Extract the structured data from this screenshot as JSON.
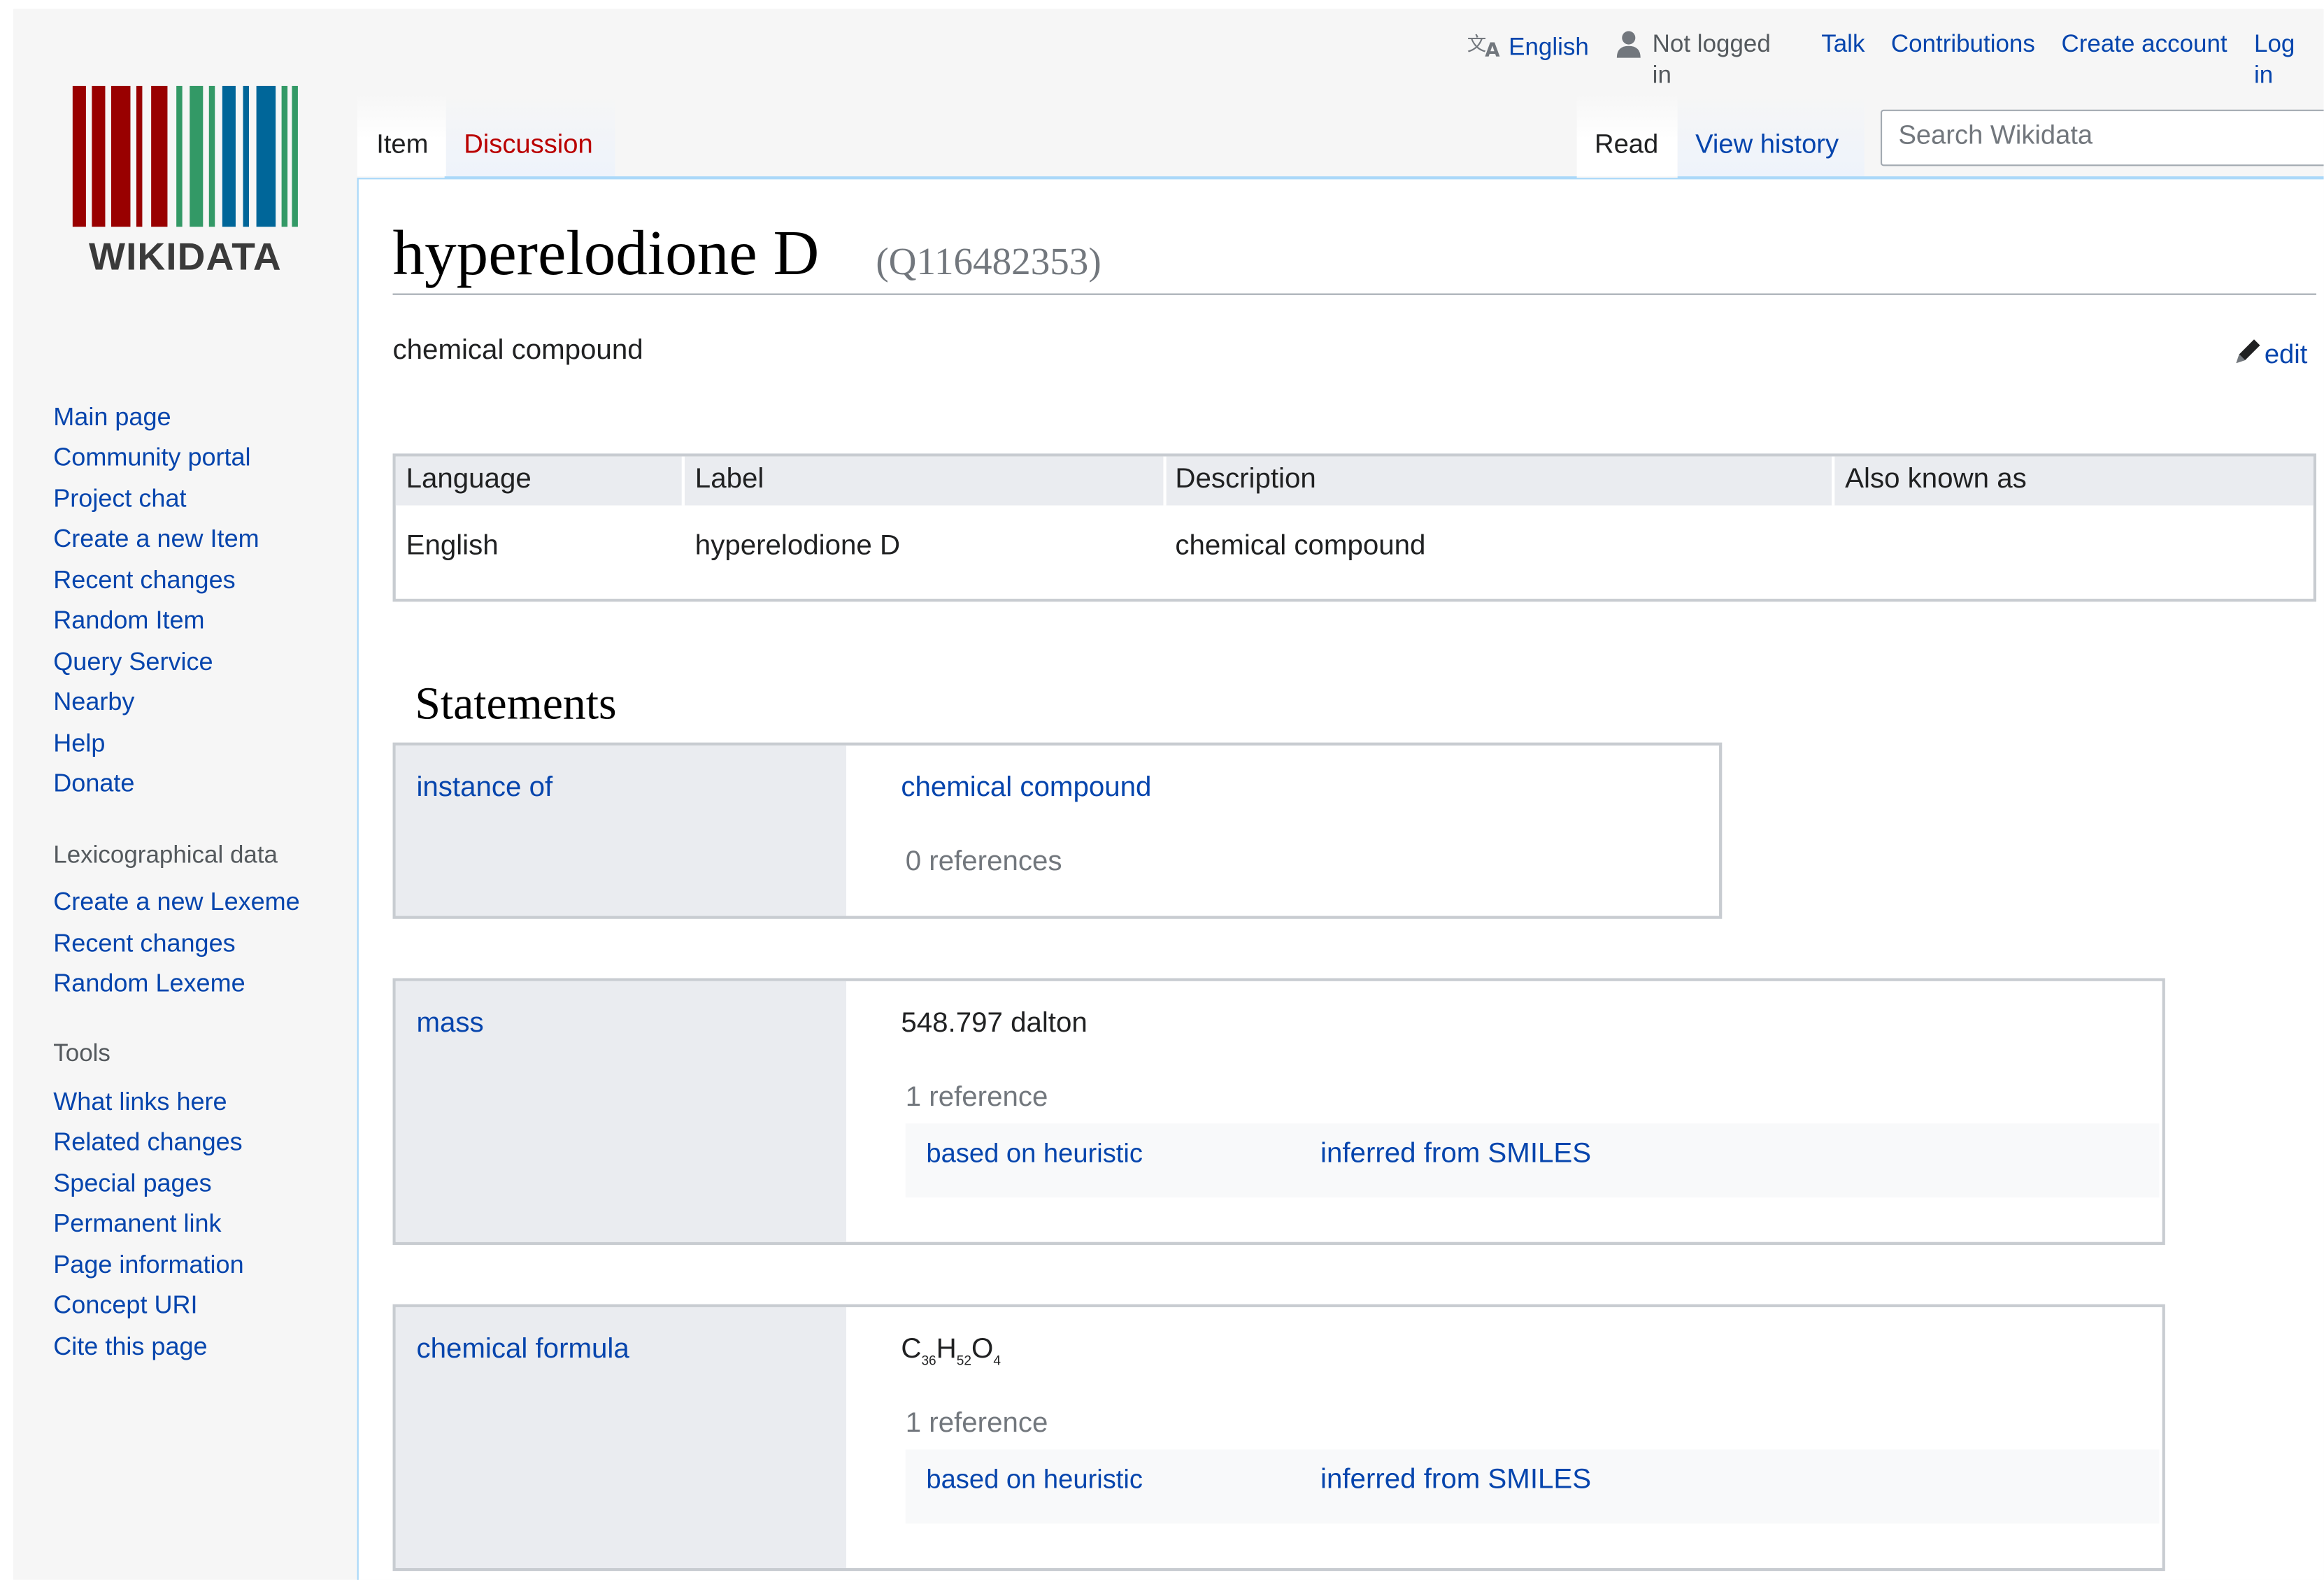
{
  "header": {
    "logo_text": "WIKIDATA",
    "personal": {
      "language": "English",
      "not_logged_in": "Not logged in",
      "talk": "Talk",
      "contributions": "Contributions",
      "create_account": "Create account",
      "log_in": "Log in"
    },
    "tabs_left": {
      "item": "Item",
      "discussion": "Discussion"
    },
    "tabs_right": {
      "read": "Read",
      "view_history": "View history"
    },
    "search": {
      "placeholder": "Search Wikidata"
    }
  },
  "sidebar": {
    "navigation": [
      "Main page",
      "Community portal",
      "Project chat",
      "Create a new Item",
      "Recent changes",
      "Random Item",
      "Query Service",
      "Nearby",
      "Help",
      "Donate"
    ],
    "lexicographical": {
      "heading": "Lexicographical data",
      "items": [
        "Create a new Lexeme",
        "Recent changes",
        "Random Lexeme"
      ]
    },
    "tools": {
      "heading": "Tools",
      "items": [
        "What links here",
        "Related changes",
        "Special pages",
        "Permanent link",
        "Page information",
        "Concept URI",
        "Cite this page"
      ]
    }
  },
  "item": {
    "label": "hyperelodione D",
    "qid": "(Q116482353)",
    "description": "chemical compound",
    "edit": "edit"
  },
  "terms": {
    "headers": [
      "Language",
      "Label",
      "Description",
      "Also known as"
    ],
    "rows": [
      {
        "language": "English",
        "label": "hyperelodione D",
        "description": "chemical compound",
        "aliases": ""
      }
    ]
  },
  "statements": {
    "title": "Statements",
    "groups": [
      {
        "property": "instance of",
        "value": "chemical compound",
        "refs_count": "0 references"
      },
      {
        "property": "mass",
        "value": "548.797 dalton",
        "refs_count": "1 reference",
        "ref_property": "based on heuristic",
        "ref_value": "inferred from SMILES"
      },
      {
        "property": "chemical formula",
        "value_parts": {
          "c": "C",
          "c_n": "36",
          "h": "H",
          "h_n": "52",
          "o": "O",
          "o_n": "4"
        },
        "refs_count": "1 reference",
        "ref_property": "based on heuristic",
        "ref_value": "inferred from SMILES"
      }
    ]
  },
  "colors": {
    "link": "#0645ad",
    "new_link": "#ba0000",
    "tab_border": "#a7d7f9",
    "panel_gray": "#eaecf0",
    "logo_red": "#990000",
    "logo_green": "#339966",
    "logo_blue": "#006699"
  }
}
